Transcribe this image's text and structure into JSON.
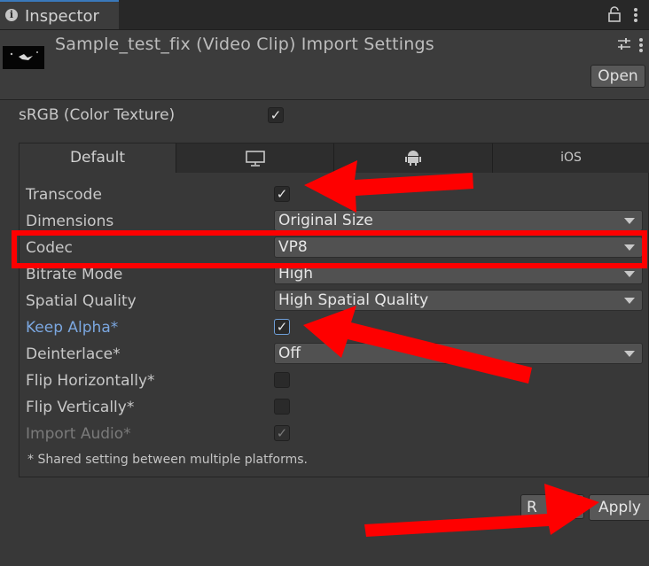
{
  "tab": {
    "title": "Inspector"
  },
  "header": {
    "title": "Sample_test_fix (Video Clip) Import Settings",
    "open_label": "Open"
  },
  "srgb": {
    "label": "sRGB (Color Texture)",
    "checked": true
  },
  "platform_tabs": [
    {
      "label": "Default",
      "active": true
    },
    {
      "label": "",
      "icon": "monitor-icon"
    },
    {
      "label": "",
      "icon": "android-icon"
    },
    {
      "label": "iOS"
    }
  ],
  "settings": {
    "transcode": {
      "label": "Transcode",
      "checked": true
    },
    "dimensions": {
      "label": "Dimensions",
      "value": "Original Size"
    },
    "codec": {
      "label": "Codec",
      "value": "VP8"
    },
    "bitrate": {
      "label": "Bitrate Mode",
      "value": "High"
    },
    "spatial": {
      "label": "Spatial Quality",
      "value": "High Spatial Quality"
    },
    "keep_alpha": {
      "label": "Keep Alpha*",
      "checked": true
    },
    "deinterlace": {
      "label": "Deinterlace*",
      "value": "Off"
    },
    "flip_h": {
      "label": "Flip Horizontally*",
      "checked": false
    },
    "flip_v": {
      "label": "Flip Vertically*",
      "checked": false
    },
    "import_audio": {
      "label": "Import Audio*",
      "checked": true
    }
  },
  "footnote": "* Shared setting between multiple platforms.",
  "buttons": {
    "revert": "R",
    "apply": "Apply"
  },
  "colors": {
    "annotation": "#fe0000",
    "accent": "#3a79bb",
    "modified_label": "#7ba7e0"
  }
}
